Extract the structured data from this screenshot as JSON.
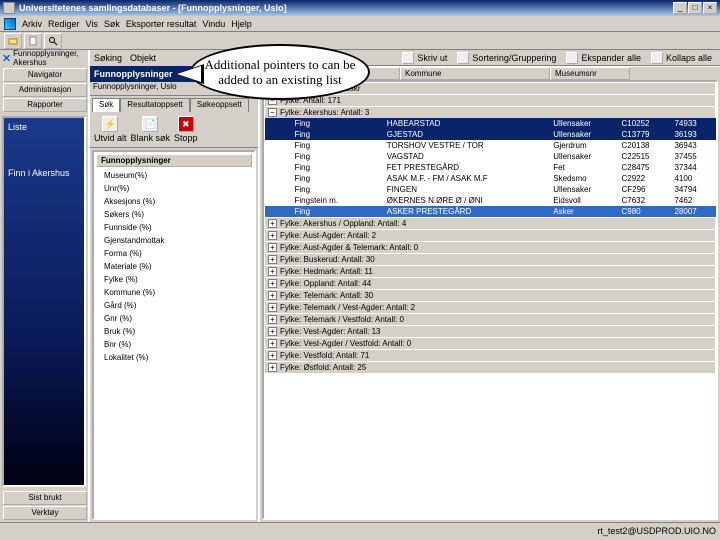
{
  "title": "Universitetenes samlingsdatabaser - [Funnopplysninger, Uslo]",
  "menus": [
    "Arkiv",
    "Rediger",
    "Vis",
    "Søk",
    "Eksporter resultat",
    "Vindu",
    "Hjelp"
  ],
  "left": {
    "hdr": "Funnopplysninger, Akershus",
    "btns": [
      "Navigator",
      "Administrasjon",
      "Rapporter"
    ],
    "blue": {
      "a": "Liste",
      "b": "Finn i Akershus"
    },
    "bottom": [
      "Sist brukt",
      "Verktøy"
    ]
  },
  "center": {
    "title": "Funnopplysninger",
    "sub": "Funnopplysninger, Uslo",
    "tabs": [
      "Søk",
      "Resultatoppsett",
      "Søkeoppsett"
    ],
    "tools": [
      "Utvid alt",
      "Blank søk",
      "Stopp"
    ],
    "treehdr": "Funnopplysninger",
    "tree": [
      "Museum(%)",
      "Unr(%)",
      "Aksesjons (%)",
      "Søkers (%)",
      "Funnside (%)",
      "Gjenstand­mottak",
      "Forma (%)",
      "Materiale (%)",
      "Fylke (%)",
      "Kommune (%)",
      "Gård (%)",
      "Gnr (%)",
      "Bruk (%)",
      "Bnr (%)",
      "Lokalitet (%)"
    ]
  },
  "right": {
    "tools": [
      "Skriv ut",
      "Sortering/Gruppering",
      "Ekspander alle",
      "Kollaps alle"
    ],
    "cols": [
      "Kommune",
      "Museumsnr"
    ],
    "groups_top": [
      "Gjenstand­stype: Beskr",
      "Fylke: Antall: 171",
      "Fylke: Akershus: Antall: 3"
    ],
    "rows": [
      {
        "sel": true,
        "c": [
          "Fing",
          "HABEARSTAD",
          "Ullensaker",
          "C10252",
          "74933"
        ]
      },
      {
        "sel": true,
        "c": [
          "Fing",
          "GJESTAD",
          "Ullensaker",
          "C13779",
          "36193"
        ]
      },
      {
        "c": [
          "Fing",
          "TORSHOV VESTRE / TOR",
          "Gjerdrum",
          "C20138",
          "36943"
        ]
      },
      {
        "c": [
          "Fing",
          "VAGSTAD",
          "Ullensaker",
          "C22515",
          "37455"
        ]
      },
      {
        "c": [
          "Fing",
          "FET PRESTEGÅRD",
          "Fet",
          "C28475",
          "37344"
        ]
      },
      {
        "c": [
          "Fing",
          "ASAK M.F. - FM / ASAK M.F",
          "Skedsmo",
          "C2922",
          "4100"
        ]
      },
      {
        "c": [
          "Fing",
          "FINGEN",
          "Ullensaker",
          "CF296",
          "34794"
        ]
      },
      {
        "c": [
          "Fingstein m.",
          "ØKERNES N.ØRE Ø / ØNI",
          "Eidsvoll",
          "C7632",
          "7462"
        ]
      },
      {
        "sel2": true,
        "c": [
          "Fing",
          "ASKER PRESTEGÅRD",
          "Asker",
          "C980",
          "28007"
        ]
      }
    ],
    "groups_bottom": [
      "Fylke: Akershus / Oppland: Antall: 4",
      "Fylke: Aust-Agder: Antall: 2",
      "Fylke: Aust-Agder & Telemark: Antall: 0",
      "Fylke: Buskerud: Antall: 30",
      "Fylke: Hedmark: Antall: 11",
      "Fylke: Oppland: Antall: 44",
      "Fylke: Telemark: Antall: 30",
      "Fylke: Telemark / Vest-Agder: Antall: 2",
      "Fylke: Telemark / Vestfold: Antall: 0",
      "Fylke: Vest-Agder: Antall: 13",
      "Fylke: Vest-Agder / Vestfold: Antall: 0",
      "Fylke: Vestfold: Antall: 71",
      "Fylke: Østfold: Antall: 25"
    ]
  },
  "status": "rt_test2@USDPROD.UIO.NO",
  "callout": "Additional pointers to can be added to an existing list"
}
